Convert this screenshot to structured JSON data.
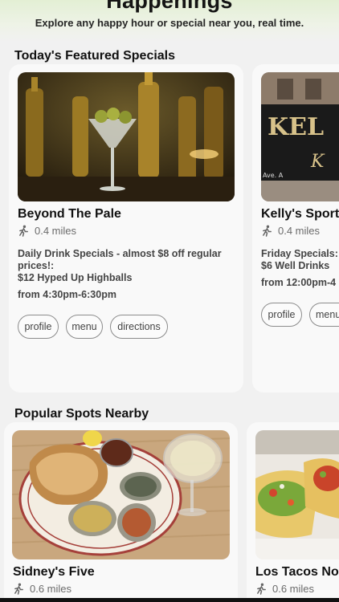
{
  "app": {
    "title": "Happenings",
    "tagline": "Explore any happy hour or special near you, real time."
  },
  "featured": {
    "section_title": "Today's Featured Specials",
    "cards": [
      {
        "name": "Beyond The Pale",
        "distance": "0.4 miles",
        "description_line1": "Daily Drink Specials - almost $8 off regular",
        "description_line2": "prices!:",
        "description_line3": "$12 Hyped Up Highballs",
        "time": "from 4:30pm-6:30pm",
        "buttons": [
          "profile",
          "menu",
          "directions"
        ]
      },
      {
        "name": "Kelly's Sports",
        "distance": "0.4 miles",
        "description_line1": "Friday Specials:",
        "description_line2": "$6 Well Drinks",
        "time": "from 12:00pm-4",
        "sign_text": "KEL",
        "sign_sub": "Ave. A",
        "buttons": [
          "profile",
          "menu"
        ]
      }
    ]
  },
  "popular": {
    "section_title": "Popular Spots Nearby",
    "cards": [
      {
        "name": "Sidney's Five",
        "distance": "0.6 miles"
      },
      {
        "name": "Los Tacos No.",
        "distance": "0.6 miles"
      }
    ]
  },
  "icons": {
    "distance": "walking-person-icon"
  },
  "colors": {
    "header_tint": "#e3efd4",
    "background": "#f1f1f1",
    "card": "#f9f9f9"
  }
}
